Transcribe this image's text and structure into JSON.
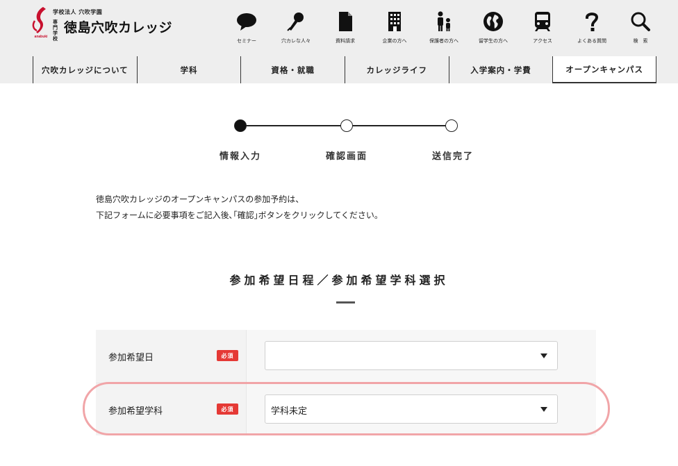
{
  "header": {
    "logo": {
      "corp_line": "学校法人 穴吹学園",
      "school_type": "専門学校",
      "name": "徳島穴吹カレッジ",
      "mark_text": "anabuki"
    },
    "utility": [
      {
        "label": "セミナー",
        "icon": "speech-bubble-icon"
      },
      {
        "label": "穴カレな人々",
        "icon": "microphone-icon"
      },
      {
        "label": "資料請求",
        "icon": "document-icon"
      },
      {
        "label": "企業の方へ",
        "icon": "building-icon"
      },
      {
        "label": "保護者の方へ",
        "icon": "parent-child-icon"
      },
      {
        "label": "留学生の方へ",
        "icon": "globe-icon"
      },
      {
        "label": "アクセス",
        "icon": "train-icon"
      },
      {
        "label": "よくある質問",
        "icon": "question-mark-icon"
      },
      {
        "label": "検　索",
        "icon": "search-icon"
      }
    ],
    "nav": [
      "穴吹カレッジについて",
      "学科",
      "資格・就職",
      "カレッジライフ",
      "入学案内・学費",
      "オープンキャンパス"
    ]
  },
  "steps": [
    "情報入力",
    "確認画面",
    "送信完了"
  ],
  "intro": {
    "line1": "徳島穴吹カレッジのオープンキャンパスの参加予約は、",
    "line2": "下記フォームに必要事項をご記入後､｢確認｣ボタンをクリックしてください。"
  },
  "section_title": "参加希望日程／参加希望学科選択",
  "form": {
    "required_badge": "必須",
    "date": {
      "label": "参加希望日",
      "value": ""
    },
    "department": {
      "label": "参加希望学科",
      "value": "学科未定"
    }
  },
  "colors": {
    "header_bg": "#eeeeee",
    "required": "#e53935",
    "highlight": "#f0a0a3",
    "logo_red": "#c8102e"
  }
}
